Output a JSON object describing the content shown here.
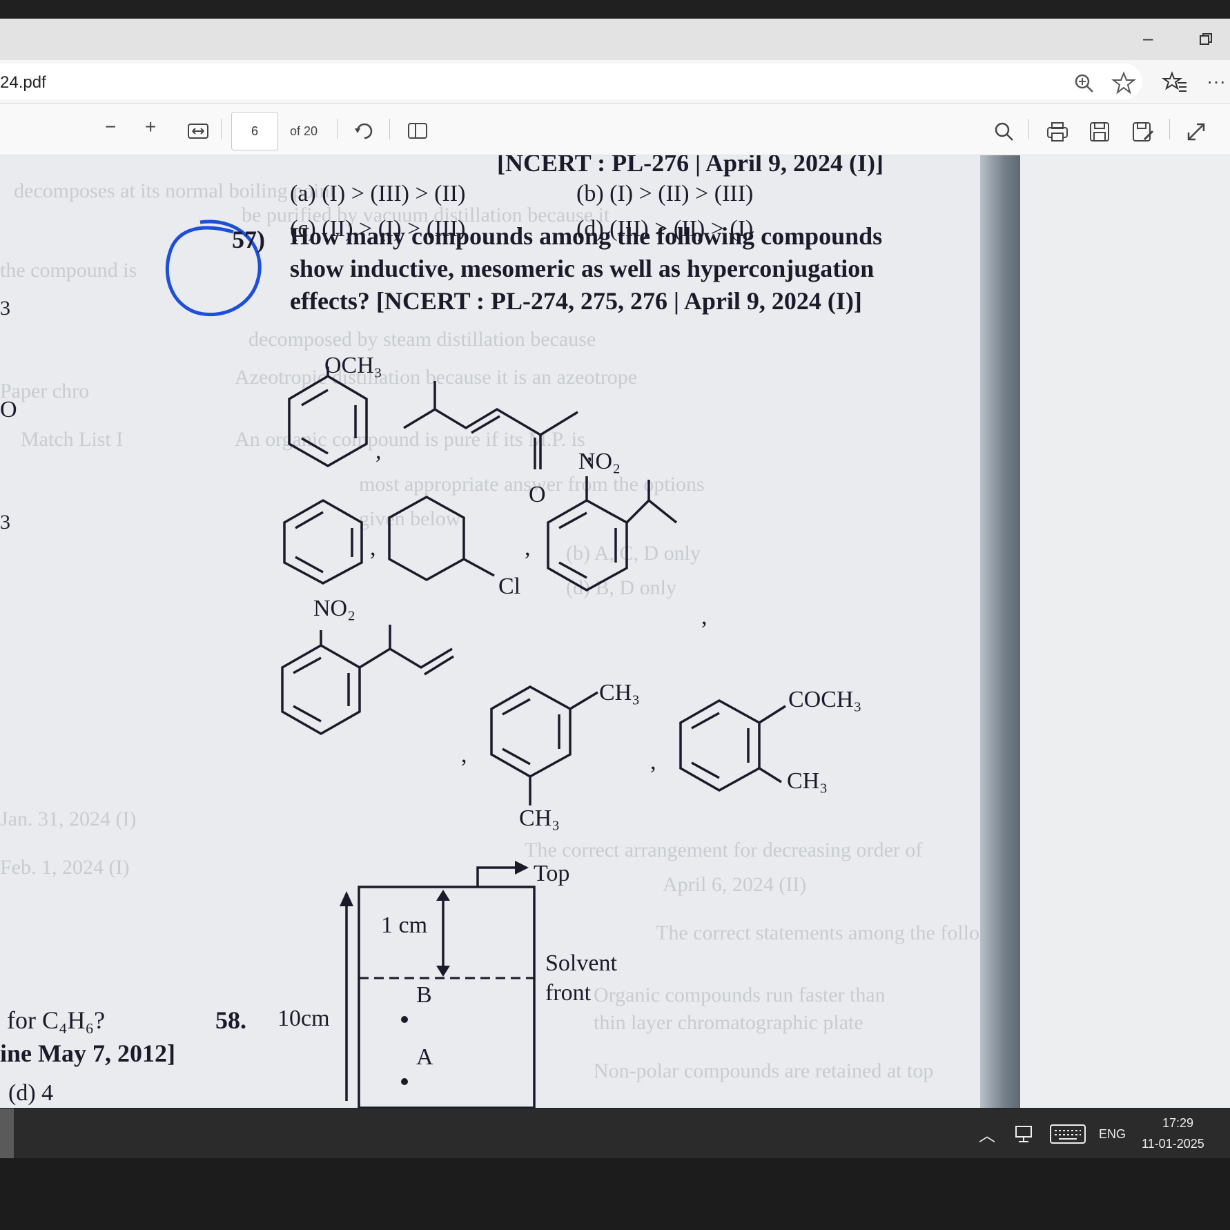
{
  "browser": {
    "file_name": "24.pdf",
    "page_number": "6",
    "page_total": "of 20"
  },
  "pdf": {
    "header_ref": "[NCERT : PL-276 | April 9, 2024 (I)]",
    "prev_options": {
      "a": "(a)   (I) > (III) > (II)",
      "b": "(b)   (I) > (II) > (III)",
      "c": "(c)   (II) > (I) > (III)",
      "d": "(d)   (III) > (II) > (I)"
    },
    "q57": {
      "number": "57)",
      "line1": "How many compounds among the following compounds",
      "line2": "show inductive, mesomeric as well as hyperconjugation",
      "line3": "effects? [NCERT : PL-274, 275, 276 | April 9, 2024 (I)]"
    },
    "labels": {
      "och3": "OCH₃",
      "o": "O",
      "no2_a": "NO₂",
      "cl": "Cl",
      "no2_b": "NO₂",
      "ch3_top": "CH₃",
      "ch3_bottom": "CH₃",
      "coch3": "COCH₃",
      "ch3_ortho": "CH₃",
      "comma": ","
    },
    "q58": {
      "number": "58.",
      "length_label": "10cm",
      "gap_label": "1 cm",
      "top_label": "Top",
      "solvent_label1": "Solvent",
      "solvent_label2": "front",
      "spot_b": "B",
      "spot_a": "A"
    },
    "left_cut": {
      "c4h6": "for C₄H₆?",
      "may2012": "ine May 7, 2012]",
      "opt_d": "(d)   4",
      "three_a": "3",
      "o_letter": "O",
      "three_b": "3"
    }
  },
  "taskbar": {
    "lang": "ENG",
    "time": "17:29",
    "date": "11-01-2025"
  }
}
